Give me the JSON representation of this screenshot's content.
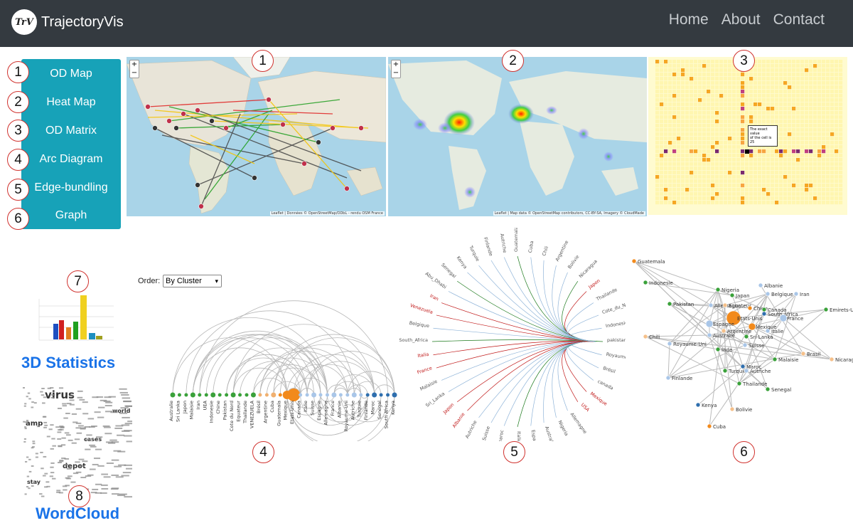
{
  "navbar": {
    "logo_text": "TrV",
    "brand": "TrajectoryVis",
    "links": [
      "Home",
      "About",
      "Contact"
    ]
  },
  "sidebar": {
    "items": [
      {
        "num": "1",
        "label": "OD Map"
      },
      {
        "num": "2",
        "label": "Heat Map"
      },
      {
        "num": "3",
        "label": "OD Matrix"
      },
      {
        "num": "4",
        "label": "Arc Diagram"
      },
      {
        "num": "5",
        "label": "Edge-bundling"
      },
      {
        "num": "6",
        "label": "Graph"
      }
    ]
  },
  "panel_numbers": [
    "1",
    "2",
    "3",
    "4",
    "5",
    "6",
    "7",
    "8"
  ],
  "map_controls": {
    "zoom_in": "+",
    "zoom_out": "−"
  },
  "od_map": {
    "attribution": "Leaflet | Données © OpenStreetMap/ODbL - rendu OSM France"
  },
  "heat_map": {
    "attribution": "Leaflet | Map data © OpenStreetMap contributors, CC-BY-SA, Imagery © CloudMade"
  },
  "od_matrix": {
    "tooltip_line1": "The exact value",
    "tooltip_line2": "of the cell is 25"
  },
  "stats_3d": {
    "label": "3D Statistics"
  },
  "wordcloud": {
    "label": "WordCloud",
    "words": [
      "virus",
      "amp",
      "depot",
      "world",
      "cases",
      "stay"
    ]
  },
  "arc_diagram": {
    "order_label": "Order:",
    "order_value": "By Cluster",
    "nodes": [
      "Australie",
      "Sri Lanka",
      "Japon",
      "Malaisie",
      "Iran",
      "UEA",
      "Indonesie",
      "Chine",
      "Pakistan",
      "Cote du Nord",
      "Equateur",
      "Thailande",
      "VENEZUELA",
      "Brésil",
      "Argentine",
      "Cuba",
      "Guatemala",
      "Mexique",
      "Etats-Unis",
      "Canada",
      "Italie",
      "Suisse",
      "Espagne",
      "Allemagne",
      "France",
      "Albanie",
      "Royaume-Uni",
      "Autriche",
      "Turquie",
      "Finlande",
      "Maroc",
      "Senegal",
      "South Africa",
      "Kenya"
    ]
  },
  "edge_bundling": {
    "labels": [
      {
        "t": "Guatemala"
      },
      {
        "t": "Cuba"
      },
      {
        "t": "Chili"
      },
      {
        "t": "Argentine"
      },
      {
        "t": "Bolivie"
      },
      {
        "t": "Nicaragua"
      },
      {
        "t": "Japon"
      },
      {
        "t": "Thailande"
      },
      {
        "t": "Cote_du_Nord"
      },
      {
        "t": "Indonesie"
      },
      {
        "t": "pakistan"
      },
      {
        "t": "Royaume-uni"
      },
      {
        "t": "Brésil"
      },
      {
        "t": "canada"
      },
      {
        "t": "Mexique"
      },
      {
        "t": "USA"
      },
      {
        "t": "Allemagne"
      },
      {
        "t": "Nigeria"
      },
      {
        "t": "Australie"
      },
      {
        "t": "Espagne"
      },
      {
        "t": "Italie"
      },
      {
        "t": "maroc"
      },
      {
        "t": "Suisse"
      },
      {
        "t": "Autriche"
      },
      {
        "t": "Albanie"
      },
      {
        "t": "Japon"
      },
      {
        "t": "Sri_Lanka"
      },
      {
        "t": "Malaisie"
      },
      {
        "t": "France"
      },
      {
        "t": "Italia"
      },
      {
        "t": "South_Africa"
      },
      {
        "t": "Belgique"
      },
      {
        "t": "Venezuela"
      },
      {
        "t": "Iran"
      },
      {
        "t": "Abu_Dhabi"
      },
      {
        "t": "Senegal"
      },
      {
        "t": "Kenya"
      },
      {
        "t": "Turquie"
      },
      {
        "t": "Finlande"
      },
      {
        "t": "Autriche"
      }
    ]
  },
  "graph": {
    "nodes": [
      {
        "id": "Guatemala"
      },
      {
        "id": "Indonesie"
      },
      {
        "id": "Pakistan"
      },
      {
        "id": "Nigeria"
      },
      {
        "id": "Albanie"
      },
      {
        "id": "Japan"
      },
      {
        "id": "Belgique"
      },
      {
        "id": "Iran"
      },
      {
        "id": "Allemagne"
      },
      {
        "id": "Equateur"
      },
      {
        "id": "Chine"
      },
      {
        "id": "Canada"
      },
      {
        "id": "Emirets-Unis"
      },
      {
        "id": "Etats-Unis"
      },
      {
        "id": "South Africa"
      },
      {
        "id": "France"
      },
      {
        "id": "Espagne"
      },
      {
        "id": "Argentine"
      },
      {
        "id": "Mexique"
      },
      {
        "id": "Australie"
      },
      {
        "id": "Sri-Lanka"
      },
      {
        "id": "Italie"
      },
      {
        "id": "Chili"
      },
      {
        "id": "Royaume-Uni"
      },
      {
        "id": "Malaisie"
      },
      {
        "id": "Suisse"
      },
      {
        "id": "Inde"
      },
      {
        "id": "Brasil"
      },
      {
        "id": "Nicaragua"
      },
      {
        "id": "Turquie"
      },
      {
        "id": "Maroc"
      },
      {
        "id": "Autriche"
      },
      {
        "id": "Finlande"
      },
      {
        "id": "Thailande"
      },
      {
        "id": "Senegal"
      },
      {
        "id": "Kenya"
      },
      {
        "id": "Bolivie"
      },
      {
        "id": "Cuba"
      }
    ]
  }
}
